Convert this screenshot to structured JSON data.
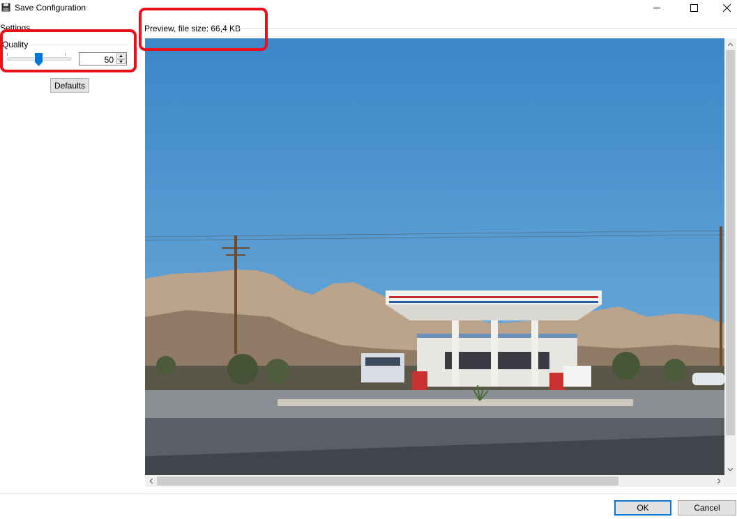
{
  "window": {
    "title": "Save Configuration",
    "icons": {
      "app": "floppy-disk-icon",
      "minimize": "minimize-icon",
      "maximize": "maximize-icon",
      "close": "close-icon"
    }
  },
  "settings": {
    "group_label": "Settings",
    "quality": {
      "label": "Quality",
      "value": "50",
      "slider_fraction": 0.5
    },
    "defaults_label": "Defaults"
  },
  "preview": {
    "label": "Preview, file size: 66,4 KB",
    "image_alt": "gas-station-desert-photo"
  },
  "footer": {
    "ok_label": "OK",
    "cancel_label": "Cancel"
  },
  "colors": {
    "highlight": "#e8101a",
    "accent": "#0078d7",
    "sky": "#3f8fd0"
  }
}
